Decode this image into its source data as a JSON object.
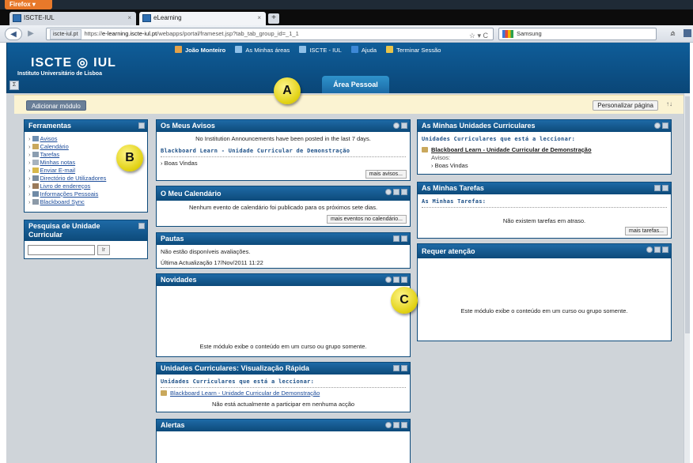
{
  "browser": {
    "app_button": "Firefox",
    "tabs": [
      {
        "title": "ISCTE-IUL"
      },
      {
        "title": "eLearning"
      }
    ],
    "new_tab": "+",
    "url_badge": "iscte-iul.pt",
    "url_prefix": "https://",
    "url_host": "e-learning.iscte-iul.pt",
    "url_path": "/webapps/portal/frameset.jsp?tab_tab_group_id=_1_1",
    "search_value": "Samsung"
  },
  "header": {
    "logo_main": "ISCTE",
    "logo_mark": "◎",
    "logo_suffix": "IUL",
    "logo_sub": "Instituto Universitário de Lisboa",
    "user_menu": [
      {
        "label": "João Monteiro",
        "color": "#e3a24a"
      },
      {
        "label": "As Minhas áreas",
        "color": "#8fc0e8"
      },
      {
        "label": "ISCTE - IUL",
        "color": "#8fc0e8"
      },
      {
        "label": "Ajuda",
        "color": "#3d88d6"
      },
      {
        "label": "Terminar Sessão",
        "color": "#e8c44a"
      }
    ],
    "active_tab": "Área Pessoal"
  },
  "actions": {
    "add_module": "Adicionar módulo",
    "personalize": "Personalizar página",
    "sort_icon": "↑↓"
  },
  "callouts": {
    "a": "A",
    "b": "B",
    "c": "C"
  },
  "modules": {
    "ferramentas": {
      "title": "Ferramentas",
      "items": [
        "Avisos",
        "Calendário",
        "Tarefas",
        "Minhas notas",
        "Enviar E-mail",
        "Directório de Utilizadores",
        "Livro de endereços",
        "Informações Pessoais",
        "Blackboard Sync"
      ]
    },
    "pesquisa": {
      "title": "Pesquisa de Unidade Curricular",
      "go_label": "Ir"
    },
    "avisos": {
      "title": "Os Meus Avisos",
      "empty": "No Institution Announcements have been posted in the last 7 days.",
      "course": "Blackboard Learn - Unidade Curricular de Demonstração",
      "item": "Boas Vindas",
      "more": "mais avisos..."
    },
    "calendario": {
      "title": "O Meu Calendário",
      "empty": "Nenhum evento de calendário foi publicado para os próximos sete dias.",
      "more": "mais eventos no calendário..."
    },
    "pautas": {
      "title": "Pautas",
      "line1": "Não estão disponíveis avaliações.",
      "line2": "Última Actualização 17/Nov/2011 11:22"
    },
    "novidades": {
      "title": "Novidades",
      "text": "Este módulo exibe o conteúdo em um curso ou grupo somente."
    },
    "rapida": {
      "title": "Unidades Curriculares: Visualização Rápida",
      "subhead": "Unidades Curriculares que está a leccionar:",
      "course": "Blackboard Learn - Unidade Curricular de Demonstração",
      "note": "Não está actualmente a participar em nenhuma acção"
    },
    "alertas": {
      "title": "Alertas"
    },
    "minhas_uc": {
      "title": "As Minhas Unidades Curriculares",
      "subhead": "Unidades Curriculares que está a leccionar:",
      "course": "Blackboard Learn - Unidade Curricular de Demonstração",
      "label": "Avisos:",
      "item": "Boas Vindas"
    },
    "tarefas": {
      "title": "As Minhas Tarefas",
      "subhead": "As Minhas Tarefas:",
      "empty": "Não existem tarefas em atraso.",
      "more": "mais tarefas..."
    },
    "atencao": {
      "title": "Requer atenção",
      "text": "Este módulo exibe o conteúdo em um curso ou grupo somente."
    }
  }
}
